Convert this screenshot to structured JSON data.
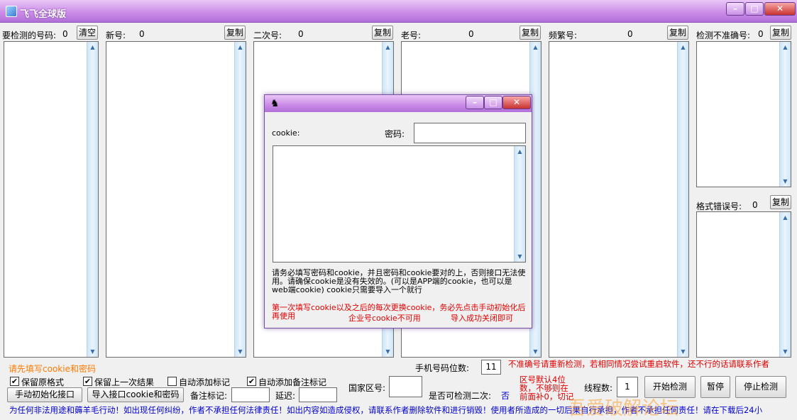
{
  "window": {
    "title": "飞飞全球版",
    "minimize": "–",
    "maximize": "□",
    "close": "✕"
  },
  "columns": [
    {
      "label": "要检测的号码:",
      "count": "0",
      "button": "清空"
    },
    {
      "label": "新号:",
      "count": "0",
      "button": "复制"
    },
    {
      "label": "二次号:",
      "count": "0",
      "button": "复制"
    },
    {
      "label": "老号:",
      "count": "0",
      "button": "复制"
    },
    {
      "label": "频繁号:",
      "count": "0",
      "button": "复制"
    },
    {
      "label": "检测不准确号:",
      "count": "0",
      "button": "复制"
    }
  ],
  "format_error": {
    "label": "格式错误号:",
    "count": "0",
    "button": "复制"
  },
  "scroll": {
    "up": "▲",
    "down": "▼"
  },
  "status": {
    "cookie_hint": "请先填写cookie和密码",
    "recheck_hint": "不准确号请重新检测，若相同情况尝试重启软件，还不行的话请联系作者"
  },
  "options": {
    "keep_format": {
      "label": "保留原格式",
      "checked": "✔"
    },
    "keep_last": {
      "label": "保留上一次结果",
      "checked": "✔"
    },
    "auto_mark": {
      "label": "自动添加标记",
      "checked": ""
    },
    "auto_note": {
      "label": "自动添加备注标记",
      "checked": "✔"
    }
  },
  "buttons": {
    "manual_init": "手动初始化接口",
    "import_cookie": "导入接口cookie和密码",
    "start": "开始检测",
    "pause": "暂停",
    "stop": "停止检测"
  },
  "fields": {
    "note_mark": {
      "label": "备注标记:",
      "value": ""
    },
    "delay": {
      "label": "延迟:",
      "value": ""
    },
    "country": {
      "label": "国家区号:",
      "value": ""
    },
    "phone_digits": {
      "label": "手机号码位数:",
      "value": "11"
    },
    "recheck": {
      "label": "是否可检测二次:",
      "value": "否"
    },
    "threads": {
      "label": "线程数:",
      "value": "1"
    }
  },
  "area_code_hint": "区号默认4位数，不够则在前面补0，切记",
  "footer": "为任何非法用途和薅羊毛行动！如出现任何纠纷，作者不承担任何法律责任！如出内容如造成侵权，请联系作者删除软件和进行销毁！使用者所造成的一切后果自行承担，作者不承担任何责任！请在下载后24小",
  "watermark": "吾爱破解论坛",
  "dialog": {
    "icon": "♞",
    "cookie_label": "cookie:",
    "password_label": "密码:",
    "password_value": "",
    "cookie_value": "",
    "info": "请务必填写密码和cookie，并且密码和cookie要对的上，否则接口无法使用。请确保cookie是没有失效的。(可以是APP端的cookie，也可以是web端cookie) cookie只需要导入一个就行",
    "warn1": "第一次填写cookie以及之后的每次更换cookie，务必先点击手动初始化后再使用",
    "warn2": "企业号cookie不可用",
    "warn3": "导入成功关闭即可"
  }
}
